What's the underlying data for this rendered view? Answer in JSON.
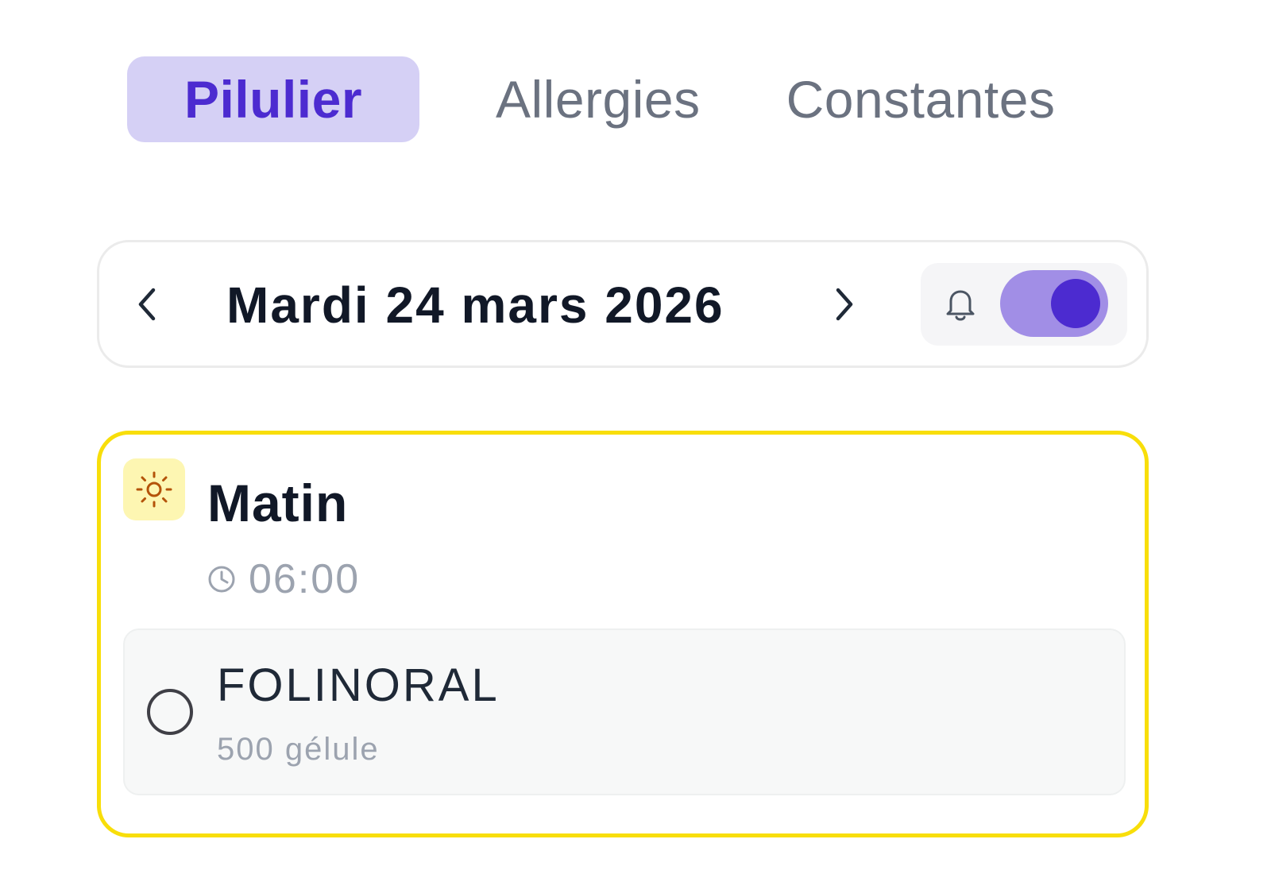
{
  "tabs": [
    {
      "label": "Pilulier",
      "active": true
    },
    {
      "label": "Allergies",
      "active": false
    },
    {
      "label": "Constantes",
      "active": false
    }
  ],
  "date_bar": {
    "date_label": "Mardi 24 mars 2026",
    "prev_icon": "chevron-left-icon",
    "next_icon": "chevron-right-icon",
    "notification_icon": "bell-icon",
    "notifications_enabled": true
  },
  "period": {
    "icon": "sun-icon",
    "title": "Matin",
    "time_icon": "clock-icon",
    "time": "06:00",
    "accent_color": "#f8de0a",
    "medications": [
      {
        "name": "FOLINORAL",
        "dose": "500 gélule",
        "taken": false
      }
    ]
  },
  "colors": {
    "primary": "#4c2bd0",
    "primary_light": "#d5d0f5",
    "toggle_track": "#a18ee6",
    "morning_badge": "#fdf6b2"
  }
}
